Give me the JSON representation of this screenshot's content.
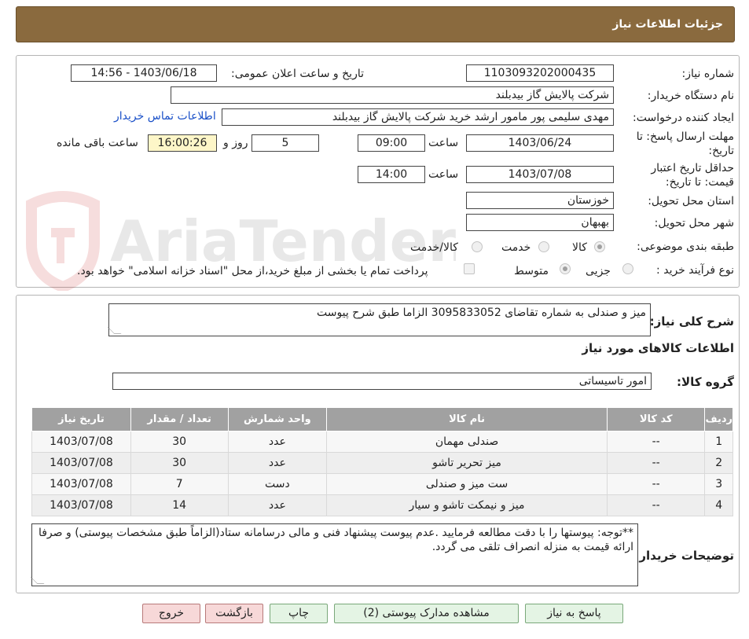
{
  "header": {
    "title": "جزئیات اطلاعات نیاز"
  },
  "form": {
    "need_number_label": "شماره نیاز:",
    "need_number": "1103093202000435",
    "announce_label": "تاریخ و ساعت اعلان عمومی:",
    "announce_value": "1403/06/18 - 14:56",
    "buyer_org_label": "نام دستگاه خریدار:",
    "buyer_org": "شرکت پالایش گاز بیدبلند",
    "creator_label": "ایجاد کننده درخواست:",
    "creator": "مهدی سلیمی پور مامور ارشد خرید شرکت پالایش گاز بیدبلند",
    "contact_link": "اطلاعات تماس خریدار",
    "deadline_label_1": "مهلت ارسال پاسخ: تا",
    "deadline_label_2": "تاریخ:",
    "deadline_date": "1403/06/24",
    "time_label": "ساعت",
    "deadline_time": "09:00",
    "days_value": "5",
    "days_label": "روز و",
    "remaining_time": "16:00:26",
    "remaining_label": "ساعت باقی مانده",
    "validity_label_1": "حداقل تاریخ اعتبار",
    "validity_label_2": "قیمت: تا تاریخ:",
    "validity_date": "1403/07/08",
    "validity_time": "14:00",
    "province_label": "استان محل تحویل:",
    "province": "خوزستان",
    "city_label": "شهر محل تحویل:",
    "city": "بهبهان",
    "category_label": "طبقه بندی موضوعی:",
    "category_options": [
      "کالا",
      "خدمت",
      "کالا/خدمت"
    ],
    "category_selected": "کالا",
    "process_label": "نوع فرآیند خرید :",
    "process_options": [
      "جزیی",
      "متوسط"
    ],
    "process_selected": "متوسط",
    "payment_note": "پرداخت تمام یا بخشی از مبلغ خرید،از محل \"اسناد خزانه اسلامی\" خواهد بود."
  },
  "watermark": {
    "text": "AriaTender.neT"
  },
  "summary": {
    "label": "شرح کلی نیاز:",
    "value": "میز و صندلی به شماره تقاضای 3095833052 الزاما طبق شرح پیوست",
    "goods_info_title": "اطلاعات کالاهای مورد نیاز",
    "group_label": "گروه کالا:",
    "group_value": "امور تاسیساتی"
  },
  "table": {
    "headers": [
      "ردیف",
      "کد کالا",
      "نام کالا",
      "واحد شمارش",
      "تعداد / مقدار",
      "تاریخ نیاز"
    ],
    "rows": [
      [
        "1",
        "--",
        "صندلی مهمان",
        "عدد",
        "30",
        "1403/07/08"
      ],
      [
        "2",
        "--",
        "میز تحریر تاشو",
        "عدد",
        "30",
        "1403/07/08"
      ],
      [
        "3",
        "--",
        "ست میز و صندلی",
        "دست",
        "7",
        "1403/07/08"
      ],
      [
        "4",
        "--",
        "میز و نیمکت تاشو و سیار",
        "عدد",
        "14",
        "1403/07/08"
      ]
    ]
  },
  "notes": {
    "label": "توضیحات خریدار:",
    "value": "**توجه: پیوستها را با دقت مطالعه فرمایید .عدم پیوست پیشنهاد فنی و مالی درسامانه ستاد(الزاماً طبق مشخصات پیوستی) و صرفا ارائه قیمت به منزله انصراف تلقی می گردد."
  },
  "buttons": {
    "reply": "پاسخ به نیاز",
    "attachments": "مشاهده مدارک پیوستی (2)",
    "print": "چاپ",
    "back": "بازگشت",
    "exit": "خروج"
  }
}
